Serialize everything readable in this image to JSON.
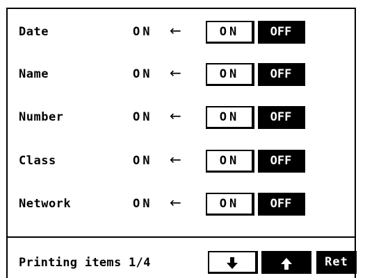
{
  "rows": [
    {
      "label": "Date",
      "state": "ON",
      "arrow": "←",
      "on_label": "ON",
      "off_label": "OFF"
    },
    {
      "label": "Name",
      "state": "ON",
      "arrow": "←",
      "on_label": "ON",
      "off_label": "OFF"
    },
    {
      "label": "Number",
      "state": "ON",
      "arrow": "←",
      "on_label": "ON",
      "off_label": "OFF"
    },
    {
      "label": "Class",
      "state": "ON",
      "arrow": "←",
      "on_label": "ON",
      "off_label": "OFF"
    },
    {
      "label": "Network",
      "state": "ON",
      "arrow": "←",
      "on_label": "ON",
      "off_label": "OFF"
    }
  ],
  "footer": {
    "label": "Printing items 1/4",
    "down_icon": "arrow-down-icon",
    "up_icon": "arrow-up-icon",
    "ret_label": "Ret"
  },
  "colors": {
    "foreground": "#000000",
    "background": "#ffffff"
  }
}
